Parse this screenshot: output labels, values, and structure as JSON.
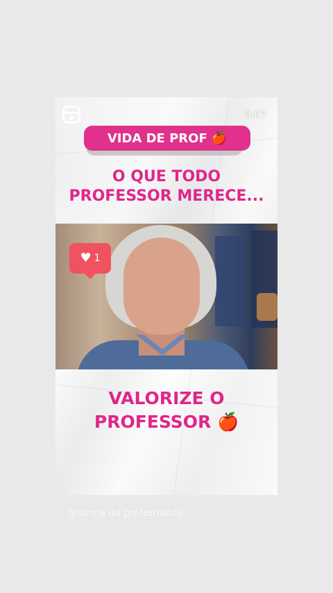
{
  "timer": "0:07",
  "badge": {
    "label": "VIDA DE PROF",
    "emoji": "🍎"
  },
  "headline_top": {
    "line1": "O QUE TODO",
    "line2": "PROFESSOR MERECE..."
  },
  "headline_bottom": {
    "line1": "VALORIZE O",
    "line2": "PROFESSOR",
    "emoji": "🍎"
  },
  "like_bubble": {
    "icon": "heart-icon",
    "count": "1"
  },
  "caption": "@turma da profernanda",
  "colors": {
    "accent": "#e0268a",
    "badge": "#e0318c",
    "like": "#f0525f"
  }
}
